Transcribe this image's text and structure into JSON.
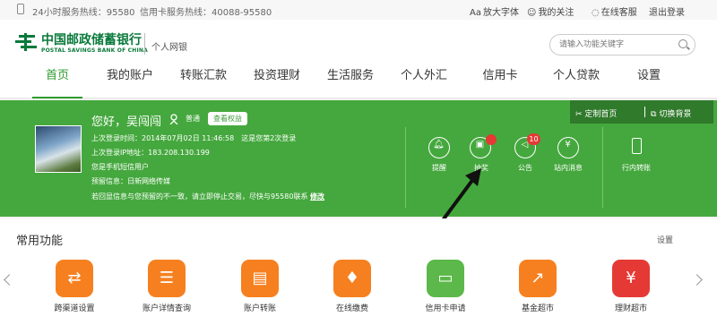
{
  "topbar": {
    "hotline_24h": "24小时服务热线：95580",
    "hotline_card": "信用卡服务热线：40088-95580",
    "font_size": "放大字体",
    "my_follow": "我的关注",
    "online_service": "在线客服",
    "logout": "退出登录",
    "font_icon": "Aa"
  },
  "header": {
    "logo_cn": "中国邮政储蓄银行",
    "logo_en": "POSTAL SAVINGS BANK OF CHINA",
    "subtitle": "个人网银",
    "search_placeholder": "请输入功能关键字"
  },
  "nav": {
    "items": [
      "首页",
      "我的账户",
      "转账汇款",
      "投资理财",
      "生活服务",
      "个人外汇",
      "信用卡",
      "个人贷款",
      "设置"
    ],
    "active": "首页"
  },
  "banner": {
    "greeting": "您好，吴闯闯",
    "level": "普通",
    "rights_button": "查看权益",
    "last_login": "上次登录时间：2014年07月02日 11:46:58　这是您第2次登录",
    "last_ip": "上次登录IP地址：183.208.130.199",
    "sms_user": "您是手机短信用户",
    "reserved_info": "预留信息：日新网络传媒",
    "warning_prefix": "若回显信息与您预留的不一致，请立即停止交易，尽快与95580联系",
    "warning_link": "修改",
    "custom_home": "定制首页",
    "switch_bg": "切换背景",
    "quick": [
      {
        "label": "提醒",
        "icon": "bell-icon"
      },
      {
        "label": "抽奖",
        "icon": "gift-icon"
      },
      {
        "label": "公告",
        "icon": "speaker-icon"
      },
      {
        "label": "站内消息",
        "icon": "yen-message-icon"
      },
      {
        "label": "行内转账",
        "icon": "phone-icon"
      }
    ],
    "announcement_count": "10"
  },
  "common": {
    "title": "常用功能",
    "settings": "设置",
    "items": [
      {
        "label": "跨渠道设置",
        "icon": "cross-channel-icon",
        "color": "#f6801f"
      },
      {
        "label": "账户详情查询",
        "icon": "coins-icon",
        "color": "#f6801f"
      },
      {
        "label": "账户转账",
        "icon": "transfer-icon",
        "color": "#f6801f"
      },
      {
        "label": "在线缴费",
        "icon": "drop-icon",
        "color": "#f6801f"
      },
      {
        "label": "信用卡申请",
        "icon": "card-icon",
        "color": "#5cb84a"
      },
      {
        "label": "基金超市",
        "icon": "chart-icon",
        "color": "#f6801f"
      },
      {
        "label": "理财超市",
        "icon": "yen-icon",
        "color": "#e53935"
      }
    ]
  },
  "colors": {
    "brand_green": "#45a83e",
    "nav_active": "#2e9a2e",
    "badge_red": "#e53935",
    "orange": "#f6801f"
  }
}
